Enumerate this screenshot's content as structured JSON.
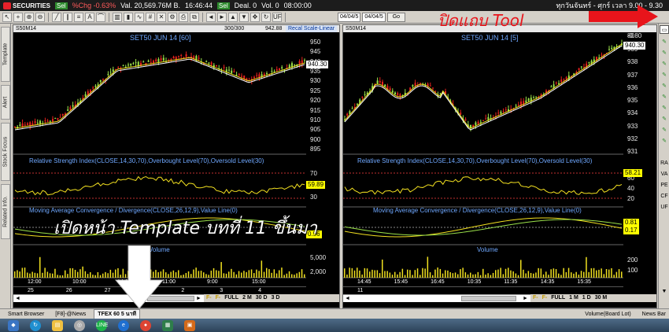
{
  "topbar": {
    "logo": "SECURITIES",
    "select_label": "Sel",
    "change_pct": "%Chg -0.63%",
    "value": "Val. 20,569.76M B.",
    "time": "16:46:44",
    "select2": "Sel",
    "deal": "Deal. 0",
    "vol": "Vol. 0",
    "time2": "08:00:00",
    "thai_hours": "ทุกวันจันทร์ - ศุกร์ เวลา 9.00 - 9.30"
  },
  "toolbar": {
    "date_from": "04/04/5",
    "date_to": "04/04/5",
    "go_label": "Go",
    "uf_label": "UF"
  },
  "left_tabs": [
    "Template",
    "Alert",
    "Stock Focus",
    "Related Info."
  ],
  "right_tabs": [
    "RA",
    "VA",
    "PE",
    "CF",
    "UF"
  ],
  "left_pane": {
    "symbol": "S50M14",
    "count": "300/300",
    "price_hdr": "942.88",
    "scale_label": "Recal Scale-Linear",
    "title": "SET50 JUN 14   [60]",
    "price_ticks": [
      "950",
      "945",
      "940",
      "935",
      "930",
      "925",
      "920",
      "915",
      "910",
      "905",
      "900",
      "895"
    ],
    "last_price": "940.30",
    "rsi_label": "Relative Strength Index(CLOSE,14,30,70),Overbought Level(70),Oversold Level(30)",
    "rsi_ticks": [
      "70",
      "50",
      "30"
    ],
    "rsi_value": "59.89",
    "macd_label": "Moving Average Convergence / Divergence(CLOSE,26,12,9),Value Line(0)",
    "macd_tag": "0.56",
    "vol_label": "Volume",
    "vol_ticks": [
      "5,000",
      "2,000"
    ],
    "time_ticks": [
      "12:00",
      "10:00",
      "14:00",
      "11:00",
      "9:00",
      "15:00"
    ],
    "day_ticks": [
      "25",
      "26",
      "27",
      "28",
      "2",
      "3",
      "4"
    ],
    "tf_buttons": [
      "F-",
      "F-",
      "FULL",
      "2 M",
      "30 D",
      "3 D"
    ]
  },
  "right_pane": {
    "symbol": "S50M14",
    "title": "SET50 JUN 14   [5]",
    "price_ticks": [
      "939",
      "938",
      "937",
      "936",
      "935",
      "934",
      "933",
      "932",
      "931"
    ],
    "last_price": "940.30",
    "rsi_label": "Relative Strength Index(CLOSE,14,30,70),Overbought Level(70),Oversold Level(30)",
    "rsi_ticks": [
      "60",
      "40",
      "20"
    ],
    "rsi_top_tick": "80",
    "rsi_value": "58.21",
    "macd_label": "Moving Average Convergence / Divergence(CLOSE,26,12,9),Value Line(0)",
    "macd_values": [
      "0.81",
      "0.17",
      "-0.80"
    ],
    "vol_label": "Volume",
    "vol_ticks": [
      "200",
      "100"
    ],
    "time_ticks": [
      "14:45",
      "15:45",
      "16:45",
      "10:35",
      "11:35",
      "14:35",
      "15:35"
    ],
    "day_ticks": [
      "11"
    ],
    "tf_buttons": [
      "F-",
      "F-",
      "FULL",
      "1 M",
      "1 D",
      "30 M"
    ]
  },
  "bottom_tabs": [
    "Smart Browser",
    "[F8]-@News",
    "TFEX 60 5 นาที"
  ],
  "bottom_right": [
    "Volume(Board Lot)",
    "News Bar"
  ],
  "overlays": {
    "thai_template": "เปิดหน้า Template บทที่ 11 ขึ้นมา",
    "red_tool": "ปิดแถบ Tool"
  },
  "colors": {
    "up": "#9be24a",
    "down": "#e8221e",
    "ma": "#f2e020",
    "ma2": "#ffffff"
  }
}
